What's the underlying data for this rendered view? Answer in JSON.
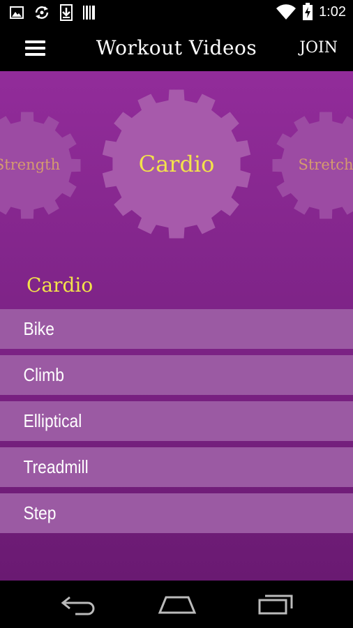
{
  "status_bar": {
    "time": "1:02",
    "icons": [
      "image-icon",
      "sync-icon",
      "download-icon",
      "barcode-icon",
      "wifi-icon",
      "battery-icon"
    ]
  },
  "app_bar": {
    "title": "Workout Videos",
    "join_label": "JOIN",
    "menu_icon": "hamburger-menu-icon"
  },
  "categories": {
    "left": "Strength",
    "selected": "Cardio",
    "right": "Stretch"
  },
  "section_title": "Cardio",
  "workouts": [
    "Bike",
    "Climb",
    "Elliptical",
    "Treadmill",
    "Step"
  ],
  "colors": {
    "background_top": "#922c9a",
    "background_bottom": "#6a1a72",
    "gear_fill": "#a75aab",
    "list_item": "#9b5aa3",
    "accent_yellow": "#f3e34a",
    "inactive_label": "#d59b6e"
  },
  "nav_bar": {
    "buttons": [
      "back-icon",
      "home-icon",
      "recent-apps-icon"
    ]
  }
}
